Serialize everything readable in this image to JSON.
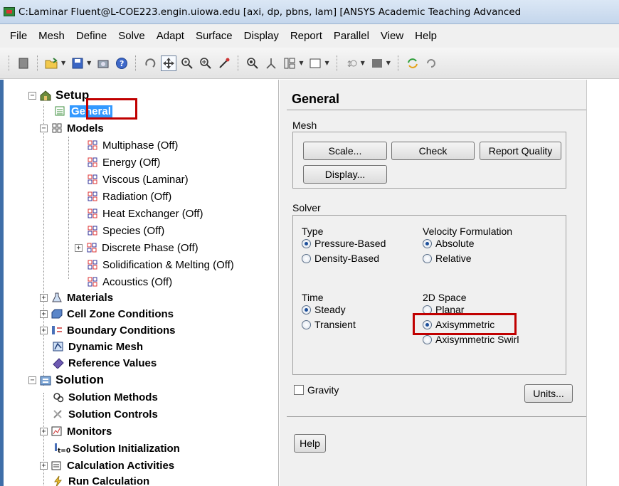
{
  "window": {
    "title": "C:Laminar Fluent@L-COE223.engin.uiowa.edu  [axi, dp, pbns, lam] [ANSYS Academic Teaching Advanced"
  },
  "menubar": {
    "items": [
      "File",
      "Mesh",
      "Define",
      "Solve",
      "Adapt",
      "Surface",
      "Display",
      "Report",
      "Parallel",
      "View",
      "Help"
    ]
  },
  "tree": {
    "setup": "Setup",
    "general": "General",
    "models": "Models",
    "model_items": [
      "Multiphase (Off)",
      "Energy (Off)",
      "Viscous (Laminar)",
      "Radiation (Off)",
      "Heat Exchanger (Off)",
      "Species (Off)",
      "Discrete Phase (Off)",
      "Solidification & Melting (Off)",
      "Acoustics (Off)"
    ],
    "materials": "Materials",
    "cell_zone": "Cell Zone Conditions",
    "boundary": "Boundary Conditions",
    "dynamic_mesh": "Dynamic Mesh",
    "reference_values": "Reference Values",
    "solution": "Solution",
    "solution_items": [
      "Solution Methods",
      "Solution Controls",
      "Monitors",
      "Solution Initialization",
      "Calculation Activities",
      "Run Calculation"
    ],
    "init_sub": "t=0"
  },
  "panel": {
    "title": "General",
    "mesh_group": "Mesh",
    "scale_button": "Scale...",
    "check_button": "Check",
    "report_quality_button": "Report Quality",
    "display_button": "Display...",
    "solver_group": "Solver",
    "type_label": "Type",
    "type_options": [
      "Pressure-Based",
      "Density-Based"
    ],
    "type_selected": "Pressure-Based",
    "velocity_label": "Velocity Formulation",
    "velocity_options": [
      "Absolute",
      "Relative"
    ],
    "velocity_selected": "Absolute",
    "time_label": "Time",
    "time_options": [
      "Steady",
      "Transient"
    ],
    "time_selected": "Steady",
    "space_label": "2D Space",
    "space_options": [
      "Planar",
      "Axisymmetric",
      "Axisymmetric Swirl"
    ],
    "space_selected": "Axisymmetric",
    "gravity_label": "Gravity",
    "gravity_checked": false,
    "units_button": "Units...",
    "help_button": "Help"
  },
  "colors": {
    "highlight": "#c00000",
    "selection": "#3399ff",
    "panel_bg": "#f0f0f0"
  },
  "icons": {
    "toolbar": [
      "load-icon",
      "open-file-icon",
      "save-icon",
      "camera-icon",
      "help-icon",
      "rotate-icon",
      "pan-icon",
      "zoom-in-icon",
      "zoom-box-icon",
      "probe-icon",
      "zoom-fit-icon",
      "transform-icon",
      "layout-icon",
      "view-box-icon",
      "mouse-probe-icon",
      "color-icon",
      "sync-icon",
      "refresh-icon"
    ]
  }
}
